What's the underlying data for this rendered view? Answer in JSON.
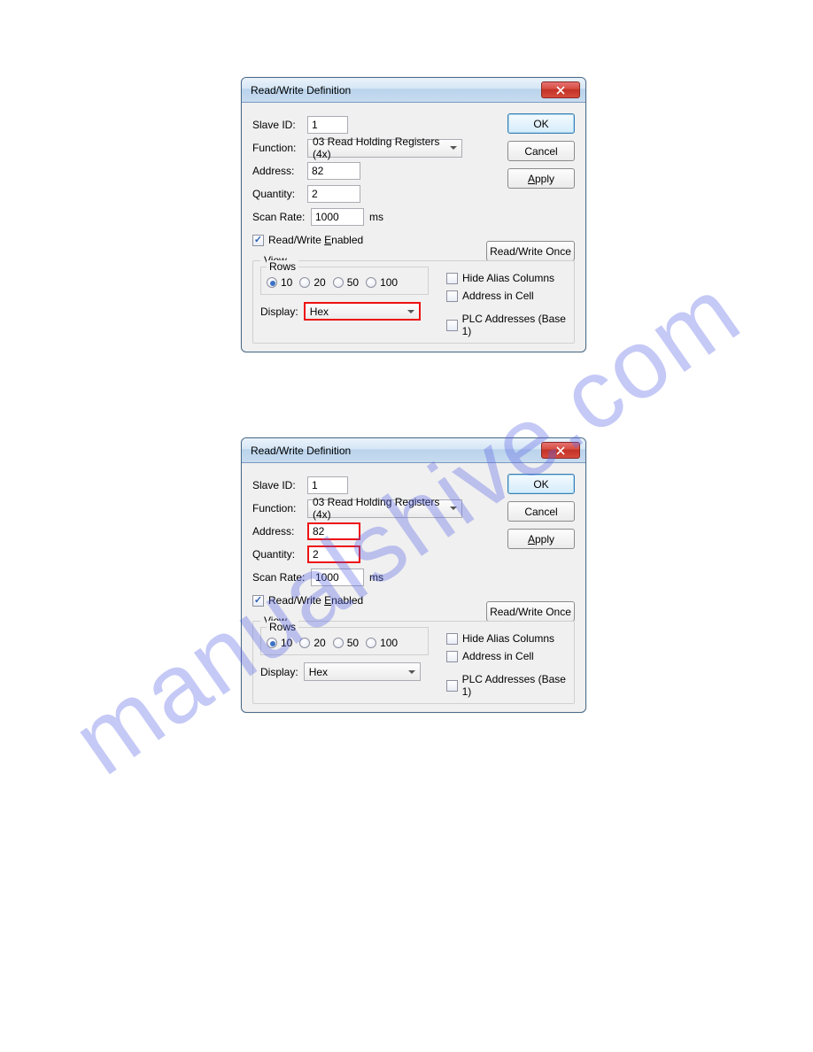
{
  "watermark": "manualshive.com",
  "dialog1": {
    "title": "Read/Write Definition",
    "labels": {
      "slaveId": "Slave ID:",
      "function": "Function:",
      "address": "Address:",
      "quantity": "Quantity:",
      "scanRate": "Scan Rate:",
      "scanUnit": "ms",
      "rwEnabled": "Read/Write Enabled",
      "view": "View",
      "rows": "Rows",
      "display": "Display:",
      "hideAlias": "Hide Alias Columns",
      "addrInCell": "Address in Cell",
      "plc": "PLC Addresses (Base 1)"
    },
    "values": {
      "slaveId": "1",
      "function": "03 Read Holding Registers (4x)",
      "address": "82",
      "quantity": "2",
      "scanRate": "1000",
      "display": "Hex"
    },
    "rowsOptions": [
      "10",
      "20",
      "50",
      "100"
    ],
    "buttons": {
      "ok": "OK",
      "cancel": "Cancel",
      "apply": "Apply",
      "rwOnce": "Read/Write Once"
    },
    "highlight": {
      "address": false,
      "quantity": false,
      "display": true
    }
  },
  "dialog2": {
    "title": "Read/Write Definition",
    "labels": {
      "slaveId": "Slave ID:",
      "function": "Function:",
      "address": "Address:",
      "quantity": "Quantity:",
      "scanRate": "Scan Rate:",
      "scanUnit": "ms",
      "rwEnabled": "Read/Write Enabled",
      "view": "View",
      "rows": "Rows",
      "display": "Display:",
      "hideAlias": "Hide Alias Columns",
      "addrInCell": "Address in Cell",
      "plc": "PLC Addresses (Base 1)"
    },
    "values": {
      "slaveId": "1",
      "function": "03 Read Holding Registers (4x)",
      "address": "82",
      "quantity": "2",
      "scanRate": "1000",
      "display": "Hex"
    },
    "rowsOptions": [
      "10",
      "20",
      "50",
      "100"
    ],
    "buttons": {
      "ok": "OK",
      "cancel": "Cancel",
      "apply": "Apply",
      "rwOnce": "Read/Write Once"
    },
    "highlight": {
      "address": true,
      "quantity": true,
      "display": false
    }
  }
}
